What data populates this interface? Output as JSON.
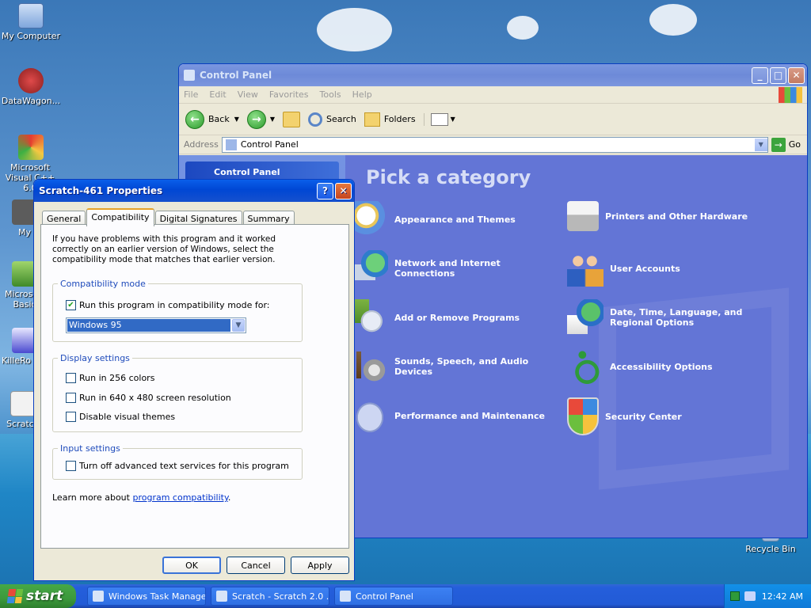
{
  "desktop": {
    "icons": [
      {
        "label": "My Computer"
      },
      {
        "label": "DataWagon..."
      },
      {
        "label": "Microsoft Visual C++ 6.0"
      },
      {
        "label": "My"
      },
      {
        "label": "Microsoft Basic"
      },
      {
        "label": "KilleRo 1.0"
      },
      {
        "label": "Scratch"
      },
      {
        "label": "Recycle Bin"
      }
    ]
  },
  "control_panel": {
    "title": "Control Panel",
    "menu": [
      "File",
      "Edit",
      "View",
      "Favorites",
      "Tools",
      "Help"
    ],
    "toolbar": {
      "back": "Back",
      "search": "Search",
      "folders": "Folders"
    },
    "address_label": "Address",
    "address_value": "Control Panel",
    "go": "Go",
    "side_title": "Control Panel",
    "heading": "Pick a category",
    "categories": [
      {
        "label": "Appearance and Themes",
        "icon": "appearance-icon"
      },
      {
        "label": "Printers and Other Hardware",
        "icon": "printer-icon"
      },
      {
        "label": "Network and Internet Connections",
        "icon": "network-icon"
      },
      {
        "label": "User Accounts",
        "icon": "users-icon"
      },
      {
        "label": "Add or Remove Programs",
        "icon": "programs-icon"
      },
      {
        "label": "Date, Time, Language, and Regional Options",
        "icon": "clock-globe-icon"
      },
      {
        "label": "Sounds, Speech, and Audio Devices",
        "icon": "sound-icon"
      },
      {
        "label": "Accessibility Options",
        "icon": "accessibility-icon"
      },
      {
        "label": "Performance and Maintenance",
        "icon": "performance-icon"
      },
      {
        "label": "Security Center",
        "icon": "shield-icon"
      }
    ]
  },
  "dialog": {
    "title": "Scratch-461 Properties",
    "tabs": [
      "General",
      "Compatibility",
      "Digital Signatures",
      "Summary"
    ],
    "intro": "If you have problems with this program and it worked correctly on an earlier version of Windows, select the compatibility mode that matches that earlier version.",
    "compat_group": "Compatibility mode",
    "compat_check": "Run this program in compatibility mode for:",
    "compat_value": "Windows 95",
    "display_group": "Display settings",
    "display_checks": [
      "Run in 256 colors",
      "Run in 640 x 480 screen resolution",
      "Disable visual themes"
    ],
    "input_group": "Input settings",
    "input_check": "Turn off advanced text services for this program",
    "learn_prefix": "Learn more about ",
    "learn_link": "program compatibility",
    "learn_suffix": ".",
    "ok": "OK",
    "cancel": "Cancel",
    "apply": "Apply"
  },
  "taskbar": {
    "start": "start",
    "tasks": [
      "Windows Task Manager",
      "Scratch - Scratch 2.0 ...",
      "Control Panel"
    ],
    "clock": "12:42 AM"
  }
}
